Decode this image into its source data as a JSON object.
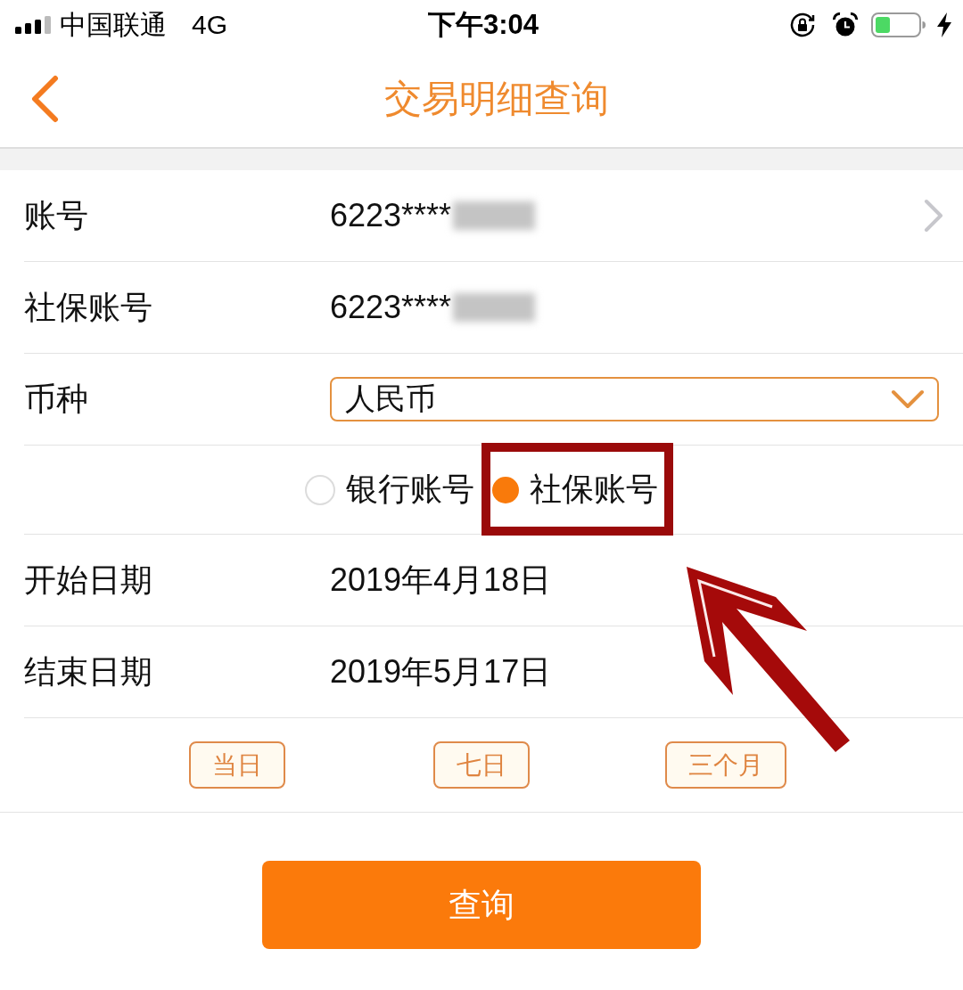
{
  "status_bar": {
    "carrier": "中国联通",
    "network": "4G",
    "time": "下午3:04"
  },
  "nav_bar": {
    "title": "交易明细查询"
  },
  "form": {
    "rows": [
      {
        "kind": "link",
        "label": "账号",
        "value": "6223****",
        "masked": true
      },
      {
        "kind": "text",
        "label": "社保账号",
        "value": "6223****",
        "masked": true
      },
      {
        "kind": "select",
        "label": "币种",
        "value": "人民币"
      },
      {
        "kind": "radio",
        "options": [
          {
            "label": "银行账号",
            "selected": false,
            "highlighted": false
          },
          {
            "label": "社保账号",
            "selected": true,
            "highlighted": true
          }
        ]
      },
      {
        "kind": "text",
        "label": "开始日期",
        "value": "2019年4月18日",
        "masked": false
      },
      {
        "kind": "text",
        "label": "结束日期",
        "value": "2019年5月17日",
        "masked": false
      },
      {
        "kind": "quick_range",
        "buttons": [
          {
            "label": "当日"
          },
          {
            "label": "七日"
          },
          {
            "label": "三个月"
          }
        ]
      }
    ]
  },
  "query_button": {
    "label": "查询"
  },
  "annotation_arrow": true
}
